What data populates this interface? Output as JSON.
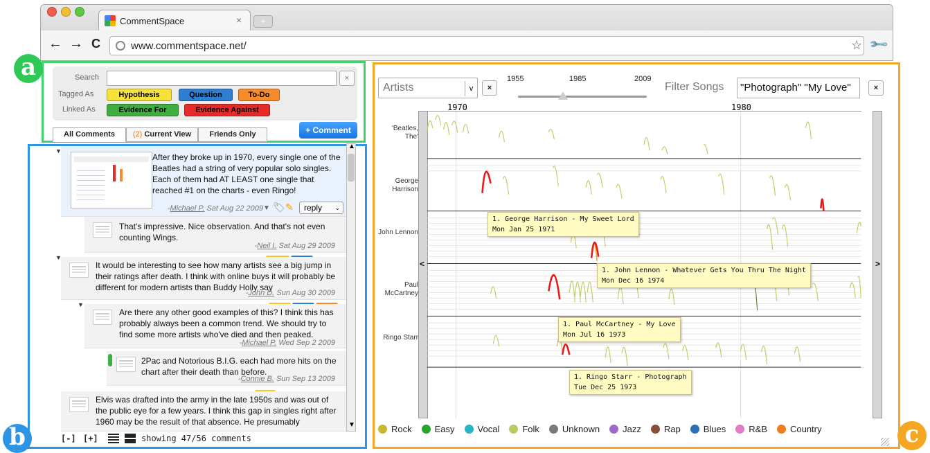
{
  "browser": {
    "tab_title": "CommentSpace",
    "tab_close": "×",
    "new_tab": "+",
    "url": "www.commentspace.net/",
    "back": "←",
    "forward": "→",
    "reload": "C"
  },
  "badges": {
    "a": "a",
    "b": "b",
    "c": "c"
  },
  "search_panel": {
    "search_label": "Search",
    "tagged_label": "Tagged As",
    "linked_label": "Linked As",
    "clear": "×",
    "tags": [
      {
        "label": "Hypothesis",
        "color": "#f7e23a"
      },
      {
        "label": "Question",
        "color": "#2f7fd1"
      },
      {
        "label": "To-Do",
        "color": "#f58b2a"
      }
    ],
    "links": [
      {
        "label": "Evidence For",
        "color": "#3fae3f"
      },
      {
        "label": "Evidence Against",
        "color": "#e52a2a"
      }
    ]
  },
  "comment_tabs": {
    "all": "All Comments",
    "current_count": "(2)",
    "current": "Current View",
    "friends": "Friends Only",
    "add": "+ Comment"
  },
  "comments": [
    {
      "text": "After they broke up in 1970, every single one of the Beatles had a string of very popular solo singles. Each of them had AT LEAST one single that reached #1 on the charts - even Ringo!",
      "author": "Michael P.",
      "date": "Sat Aug 22 2009",
      "reply": "reply"
    },
    {
      "text": "That's impressive. Nice observation. And that's not even counting Wings.",
      "author": "Neil I.",
      "date": "Sat Aug 29 2009"
    },
    {
      "text": "It would be interesting to see how many artists see a big jump in their ratings after death. I think with online buys it will probably be different for modern artists than Buddy Holly say",
      "author": "John D.",
      "date": "Sun Aug 30 2009"
    },
    {
      "text": "Are there any other good examples of this? I think this has probably always been a common trend. We should try to find some more artists who've died and then peaked.",
      "author": "Michael P.",
      "date": "Wed Sep 2 2009"
    },
    {
      "text": "2Pac and Notorious B.I.G. each had more hits on the chart after their death than before.",
      "author": "Connie B.",
      "date": "Sun Sep 13 2009"
    },
    {
      "text": "Elvis was drafted into the army in the late 1950s and was out of the public eye for a few years. I think this gap in singles right after 1960 may be the result of that absence. He presumably"
    }
  ],
  "footer": {
    "collapse": "[-]",
    "expand": "[+]",
    "status": "showing 47/56 comments"
  },
  "viz": {
    "select_value": "Artists",
    "select_arrow": "v",
    "clear": "×",
    "slider_min": "1955",
    "slider_mid": "1985",
    "slider_max": "2009",
    "filter_label": "Filter Songs",
    "filter_value": "\"Photograph\" \"My Love\"",
    "nav_left": "<",
    "nav_right": ">",
    "x_ticks": [
      "1970",
      "1980"
    ],
    "artists": [
      "'Beatles, The'",
      "George Harrison",
      "John Lennon",
      "Paul McCartney",
      "Ringo Starr"
    ],
    "tooltips": [
      {
        "line1": "1. George Harrison - My Sweet Lord",
        "line2": "Mon Jan 25 1971"
      },
      {
        "line1": "1. John Lennon - Whatever Gets You Thru The Night",
        "line2": "Mon Dec 16 1974"
      },
      {
        "line1": "1. Paul McCartney - My Love",
        "line2": "Mon Jul 16 1973"
      },
      {
        "line1": "1. Ringo Starr - Photograph",
        "line2": "Tue Dec 25 1973"
      }
    ],
    "legend": [
      {
        "label": "Rock",
        "color": "#c8b834"
      },
      {
        "label": "Easy",
        "color": "#2aa52a"
      },
      {
        "label": "Vocal",
        "color": "#24b6c9"
      },
      {
        "label": "Folk",
        "color": "#b6cc62"
      },
      {
        "label": "Unknown",
        "color": "#7a7a7a"
      },
      {
        "label": "Jazz",
        "color": "#9c6ccc"
      },
      {
        "label": "Rap",
        "color": "#8a4f3b"
      },
      {
        "label": "Blues",
        "color": "#2a6fb8"
      },
      {
        "label": "R&B",
        "color": "#e37bc6"
      },
      {
        "label": "Country",
        "color": "#f07d1e"
      }
    ]
  }
}
